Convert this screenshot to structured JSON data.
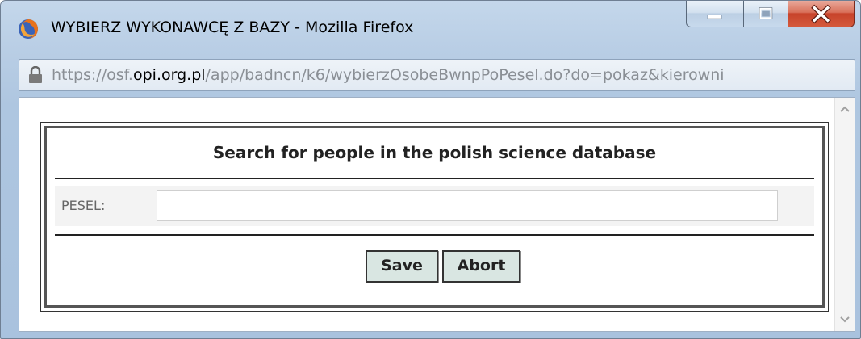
{
  "window": {
    "title": "WYBIERZ WYKONAWCĘ Z BAZY - Mozilla Firefox",
    "icon": "firefox-icon",
    "controls": [
      "minimize-icon",
      "maximize-icon",
      "close-icon"
    ],
    "close_color": "#c7432a"
  },
  "urlbar": {
    "prefix": "https://osf.",
    "host": "opi.org.pl",
    "path": "/app/badncn/k6/wybierzOsobeBwnpPoPesel.do?do=pokaz&kierowni",
    "icon": "lock-icon"
  },
  "dialog": {
    "heading": "Search for people in the polish science database",
    "field_label": "PESEL:",
    "field_value": "",
    "save_label": "Save",
    "abort_label": "Abort",
    "button_color": "#d9e6e2"
  }
}
